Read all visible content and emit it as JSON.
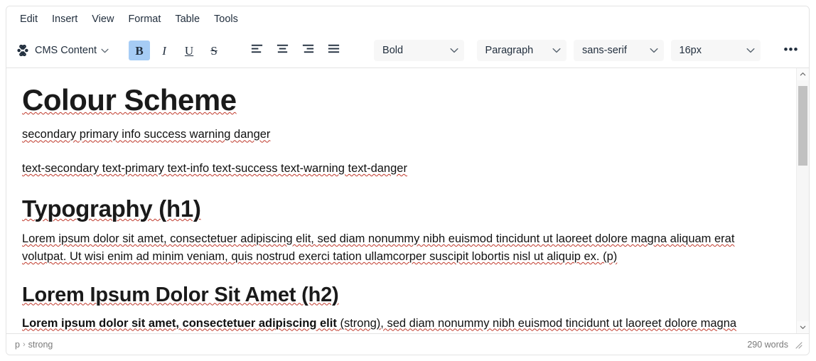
{
  "menubar": {
    "items": [
      {
        "label": "Edit"
      },
      {
        "label": "Insert"
      },
      {
        "label": "View"
      },
      {
        "label": "Format"
      },
      {
        "label": "Table"
      },
      {
        "label": "Tools"
      }
    ]
  },
  "toolbar": {
    "cms_button": {
      "label": "CMS Content",
      "icon": "joomla-logo-icon",
      "chevron": "chevron-down-icon"
    },
    "format_buttons": [
      {
        "name": "bold",
        "glyph": "B",
        "active": true
      },
      {
        "name": "italic",
        "glyph": "I",
        "active": false
      },
      {
        "name": "underline",
        "glyph": "U",
        "active": false
      },
      {
        "name": "strikethrough",
        "glyph": "S",
        "active": false
      }
    ],
    "align_buttons": [
      {
        "name": "align-left"
      },
      {
        "name": "align-center"
      },
      {
        "name": "align-right"
      },
      {
        "name": "align-justify"
      }
    ],
    "selects": [
      {
        "name": "style-select",
        "value": "Bold"
      },
      {
        "name": "block-select",
        "value": "Paragraph"
      },
      {
        "name": "fontfamily-select",
        "value": "sans-serif"
      },
      {
        "name": "fontsize-select",
        "value": "16px"
      }
    ],
    "overflow_label": "•••"
  },
  "document": {
    "h1_colour": "Colour Scheme",
    "swatches_line": "secondary primary info success warning danger",
    "text_colours_line": "text-secondary text-primary text-info text-success text-warning text-danger",
    "h1_typography": "Typography (h1)",
    "p1": "Lorem ipsum dolor sit amet, consectetuer adipiscing elit, sed diam nonummy nibh euismod tincidunt ut laoreet dolore magna aliquam erat volutpat. Ut wisi enim ad minim veniam, quis nostrud exerci tation ullamcorper suscipit lobortis nisl ut aliquip ex. (p)",
    "h2_lorem": "Lorem Ipsum Dolor Sit Amet (h2)",
    "p2_strong": "Lorem ipsum dolor sit amet, consectetuer adipiscing elit",
    "p2_rest": " (strong), sed diam nonummy nibh euismod tincidunt ut laoreet dolore magna aliquam erat volutpat. Ut wisi enim ad minim veniam, quis nostrud exerci tation ullamcorper suscipit lobortis nisl ut aliquip ex. (p)"
  },
  "scrollbar": {
    "up_icon": "chevron-up-icon",
    "down_icon": "chevron-down-icon"
  },
  "statusbar": {
    "path_parts": [
      "p",
      "strong"
    ],
    "path_separator": "›",
    "wordcount": "290 words",
    "resize_icon": "resize-grip-icon"
  },
  "colors": {
    "active_button_bg": "#a6ccf5",
    "spellcheck_underline": "#c0392b",
    "border": "#e3e3e3",
    "muted_text": "#7a7a7a",
    "select_bg": "#f7f7f7",
    "scrollbar_thumb": "#c1c1c1"
  }
}
